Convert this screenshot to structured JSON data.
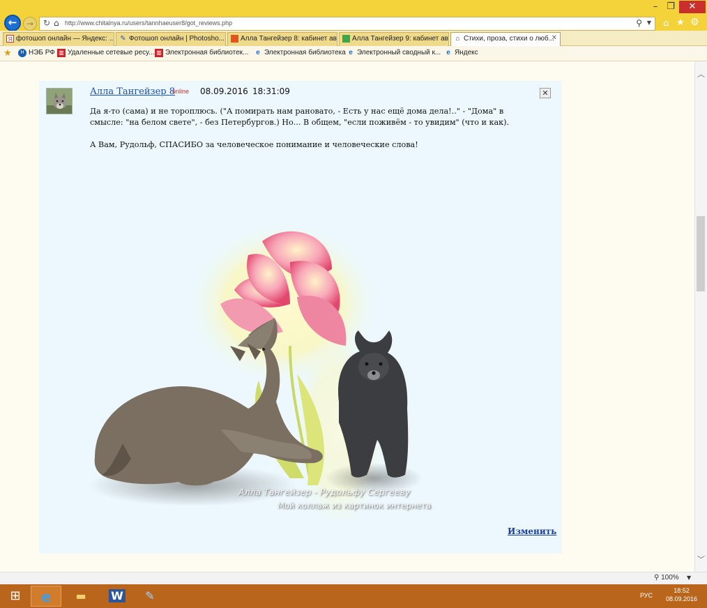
{
  "browser": {
    "address_url": "http://www.chitalnya.ru/users/tannhaeuser8/got_reviews.php",
    "tabs": [
      {
        "label": "фотошоп онлайн — Яндекс: ...",
        "icon": "yandex-icon"
      },
      {
        "label": "Фотошоп онлайн | Photosho...",
        "icon": "feather-icon"
      },
      {
        "label": "Алла Тангейзер 8: кабинет ав...",
        "icon": "orange-square-icon"
      },
      {
        "label": "Алла Тангейзер 9: кабинет ав...",
        "icon": "green-square-icon"
      },
      {
        "label": "Стихи, проза, стихи о люб...",
        "icon": "page-icon"
      }
    ],
    "favorites": [
      {
        "label": "НЭБ РФ",
        "icon": "neb-icon"
      },
      {
        "label": "Удаленные сетевые ресу...",
        "icon": "library-icon"
      },
      {
        "label": "Электронная библиотек...",
        "icon": "library-icon"
      },
      {
        "label": "Электронная библиотека",
        "icon": "ie-icon"
      },
      {
        "label": "Электронный сводный к...",
        "icon": "ie-icon"
      },
      {
        "label": "Яндекс",
        "icon": "ie-icon"
      }
    ],
    "zoom": "100%",
    "theme_color": "#f3d23a"
  },
  "review": {
    "author": "Алла Тангейзер 8",
    "status": "online",
    "date": "08.09.2016",
    "time": "18:31:09",
    "paragraph1_line1": "Да я-то (сама) и не тороплюсь. (\"А помирать нам рановато, - Есть у нас ещё дома дела!..\" - \"Дома\" в",
    "paragraph1_line2": "смысле: \"на белом свете\", - без Петербургов.) Но... В общем, \"если поживём - то увидим\" (что и как).",
    "paragraph2": "А Вам, Рудольф, СПАСИБО за человеческое понимание и человеческие слова!",
    "image_signature": "Алла Тангейзер - Рудольфу Сергееву",
    "image_caption": "Мой коллаж из картинок интернета",
    "edit_label": "Изменить"
  },
  "taskbar": {
    "language": "РУС",
    "time": "18:52",
    "date": "08.09.2016"
  }
}
